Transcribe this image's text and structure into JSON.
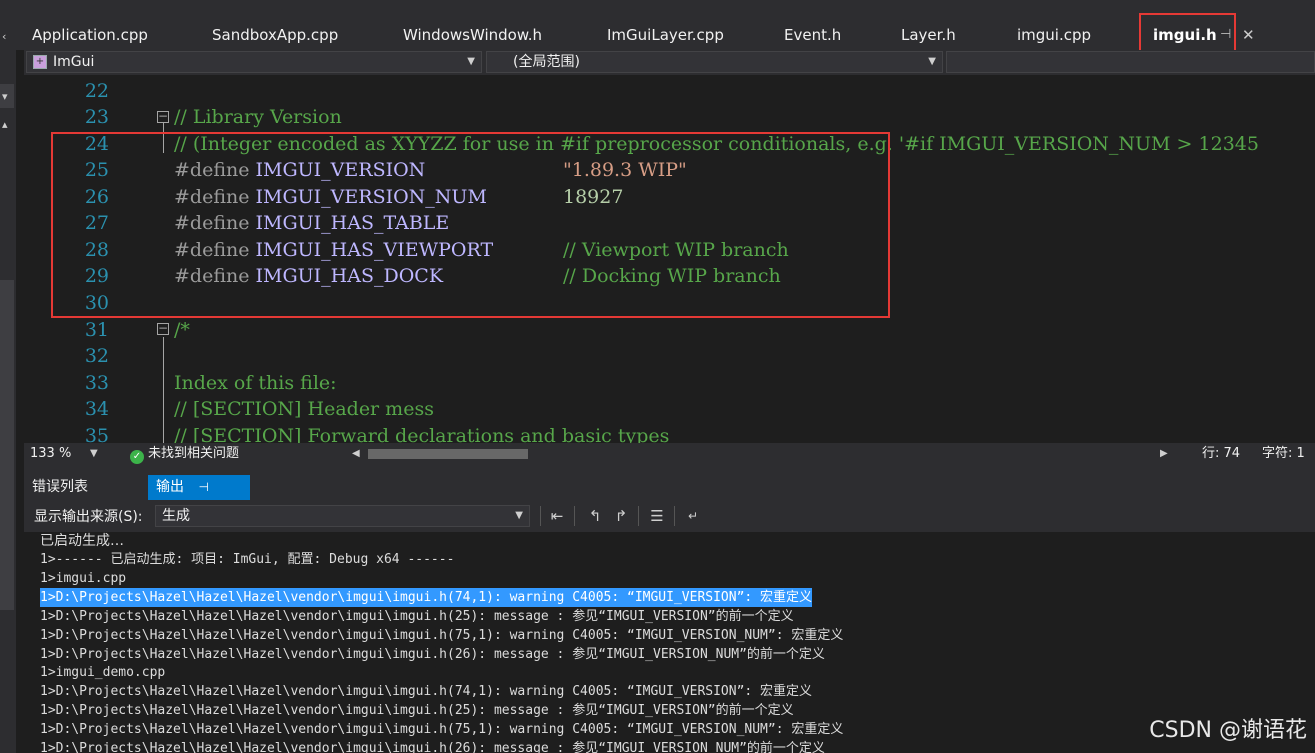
{
  "tabs": [
    {
      "label": "Application.cpp",
      "active": false
    },
    {
      "label": "SandboxApp.cpp",
      "active": false
    },
    {
      "label": "WindowsWindow.h",
      "active": false
    },
    {
      "label": "ImGuiLayer.cpp",
      "active": false
    },
    {
      "label": "Event.h",
      "active": false
    },
    {
      "label": "Layer.h",
      "active": false
    },
    {
      "label": "imgui.cpp",
      "active": false
    },
    {
      "label": "imgui.h",
      "active": true
    }
  ],
  "navbar": {
    "project": "ImGui",
    "scope": "(全局范围)"
  },
  "editor": {
    "line_numbers": [
      "22",
      "23",
      "24",
      "25",
      "26",
      "27",
      "28",
      "29",
      "30",
      "31",
      "32",
      "33",
      "34",
      "35"
    ],
    "lines": {
      "l23": "// Library Version",
      "l24": "// (Integer encoded as XYYZZ for use in #if preprocessor conditionals, e.g. '#if IMGUI_VERSION_NUM > 12345",
      "define_kw": "#define",
      "l25_macro": "IMGUI_VERSION",
      "l25_value": "\"1.89.3 WIP\"",
      "l26_macro": "IMGUI_VERSION_NUM",
      "l26_value": "18927",
      "l27_macro": "IMGUI_HAS_TABLE",
      "l28_macro": "IMGUI_HAS_VIEWPORT",
      "l28_comment": "// Viewport WIP branch",
      "l29_macro": "IMGUI_HAS_DOCK",
      "l29_comment": "// Docking WIP branch",
      "l31": "/*",
      "l33": "Index of this file:",
      "l34": "// [SECTION] Header mess",
      "l35": "// [SECTION] Forward declarations and basic types"
    }
  },
  "statusbar": {
    "zoom": "133 %",
    "issues": "未找到相关问题",
    "line": "行: 74",
    "char": "字符: 1"
  },
  "output_panel": {
    "tabs": [
      {
        "label": "错误列表",
        "active": false
      },
      {
        "label": "输出",
        "active": true
      }
    ],
    "source_label": "显示输出来源(S):",
    "source_value": "生成",
    "lines": [
      "已启动生成…",
      "1>------ 已启动生成: 项目: ImGui, 配置: Debug x64 ------",
      "1>imgui.cpp",
      "1>D:\\Projects\\Hazel\\Hazel\\Hazel\\vendor\\imgui\\imgui.h(74,1): warning C4005: “IMGUI_VERSION”: 宏重定义",
      "1>D:\\Projects\\Hazel\\Hazel\\Hazel\\vendor\\imgui\\imgui.h(25): message : 参见“IMGUI_VERSION”的前一个定义",
      "1>D:\\Projects\\Hazel\\Hazel\\Hazel\\vendor\\imgui\\imgui.h(75,1): warning C4005: “IMGUI_VERSION_NUM”: 宏重定义",
      "1>D:\\Projects\\Hazel\\Hazel\\Hazel\\vendor\\imgui\\imgui.h(26): message : 参见“IMGUI_VERSION_NUM”的前一个定义",
      "1>imgui_demo.cpp",
      "1>D:\\Projects\\Hazel\\Hazel\\Hazel\\vendor\\imgui\\imgui.h(74,1): warning C4005: “IMGUI_VERSION”: 宏重定义",
      "1>D:\\Projects\\Hazel\\Hazel\\Hazel\\vendor\\imgui\\imgui.h(25): message : 参见“IMGUI_VERSION”的前一个定义",
      "1>D:\\Projects\\Hazel\\Hazel\\Hazel\\vendor\\imgui\\imgui.h(75,1): warning C4005: “IMGUI_VERSION_NUM”: 宏重定义",
      "1>D:\\Projects\\Hazel\\Hazel\\Hazel\\vendor\\imgui\\imgui.h(26): message : 参见“IMGUI_VERSION_NUM”的前一个定义"
    ],
    "selected_line": 3
  },
  "watermark": "CSDN @谢语花",
  "colors": {
    "accent": "#007acc",
    "highlight_box": "#e53935",
    "selection": "#3399ff"
  }
}
